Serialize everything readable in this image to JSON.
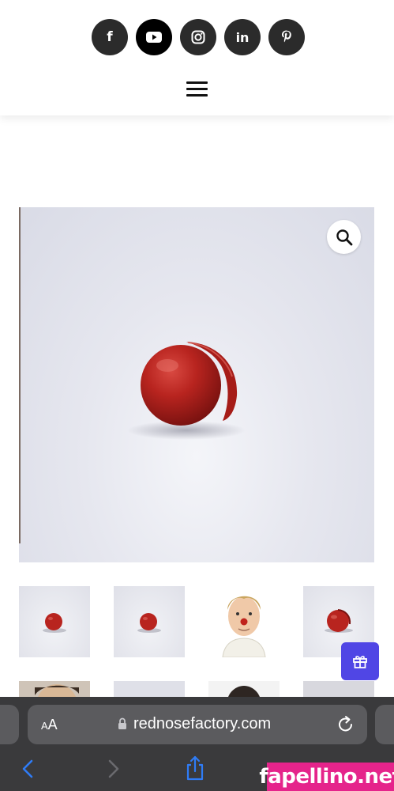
{
  "header": {
    "social_icons": [
      {
        "name": "facebook-icon",
        "glyph": "f"
      },
      {
        "name": "youtube-icon",
        "glyph": "▶"
      },
      {
        "name": "instagram-icon",
        "glyph": ""
      },
      {
        "name": "linkedin-icon",
        "glyph": "in"
      },
      {
        "name": "pinterest-icon",
        "glyph": "p"
      }
    ],
    "menu_icon": "hamburger-menu-icon"
  },
  "product": {
    "main_image": "red-clown-nose-photo",
    "zoom_icon": "magnifier-icon",
    "thumbnails": [
      "red-nose-thumb",
      "red-nose-thumb",
      "person-with-red-nose-thumb",
      "red-nose-thumb"
    ],
    "gift_icon": "gift-icon"
  },
  "browser": {
    "text_size_label_small": "A",
    "text_size_label_large": "A",
    "url": "rednosefactory.com",
    "lock_icon": "lock-icon",
    "reload_icon": "reload-icon"
  },
  "watermark": "fapellino.net",
  "colors": {
    "social_bg": "#2b2b2b",
    "gift_button": "#5046e5",
    "safari_bar": "#3a3a3c",
    "url_field": "#5b5b5e",
    "watermark_bg": "#e5248b"
  }
}
